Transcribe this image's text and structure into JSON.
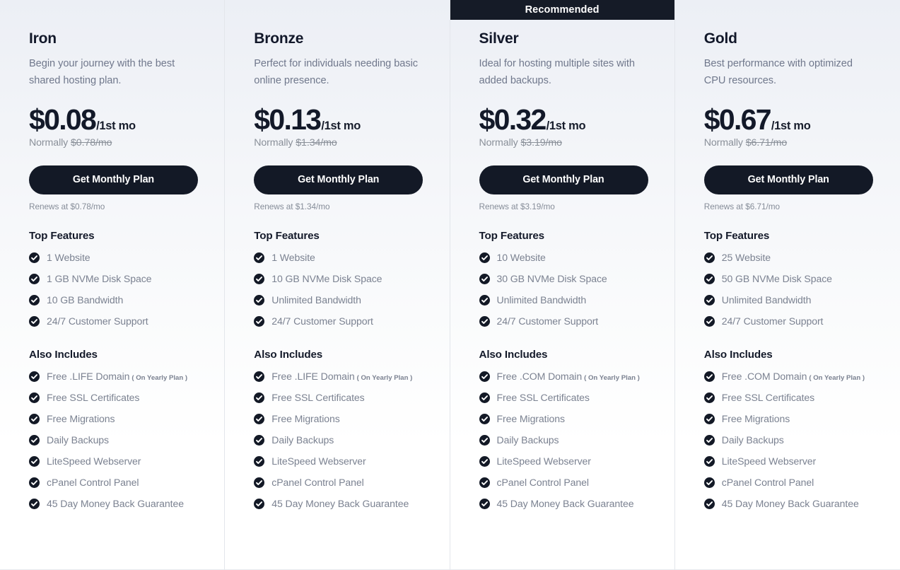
{
  "theme": {
    "accent_dark": "#131926",
    "banner_bg": "#151b27",
    "text_primary": "#12182a",
    "text_muted": "#70788c",
    "feature_text": "#7b8291",
    "divider": "#e3e6eb",
    "card_gradient_top": "#eceff5",
    "card_gradient_bottom": "#ffffff"
  },
  "labels": {
    "top_features_title": "Top Features",
    "also_includes_title": "Also Includes",
    "recommended_badge": "Recommended",
    "cta_label": "Get Monthly Plan",
    "normally_prefix": "Normally",
    "renews_prefix": "Renews at",
    "yearly_note": "( On Yearly Plan )",
    "check_icon_name": "check-circle-icon"
  },
  "plans": [
    {
      "name": "Iron",
      "description": "Begin your journey with the best shared hosting plan.",
      "price": "$0.08",
      "price_suffix": "/1st mo",
      "normally_price": "$0.78/mo",
      "normally_text": "Normally $0.78/mo",
      "cta_label": "Get Monthly Plan",
      "renews_text": "Renews at $0.78/mo",
      "recommended": false,
      "top_features": [
        "1 Website",
        "1 GB NVMe Disk Space",
        "10 GB Bandwidth",
        "24/7 Customer Support"
      ],
      "also_includes": [
        {
          "text": "Free .LIFE Domain",
          "note": "( On Yearly Plan )"
        },
        {
          "text": "Free SSL Certificates",
          "note": ""
        },
        {
          "text": "Free Migrations",
          "note": ""
        },
        {
          "text": "Daily Backups",
          "note": ""
        },
        {
          "text": "LiteSpeed Webserver",
          "note": ""
        },
        {
          "text": "cPanel Control Panel",
          "note": ""
        },
        {
          "text": "45 Day Money Back Guarantee",
          "note": ""
        }
      ]
    },
    {
      "name": "Bronze",
      "description": "Perfect for individuals needing basic online presence.",
      "price": "$0.13",
      "price_suffix": "/1st mo",
      "normally_price": "$1.34/mo",
      "normally_text": "Normally $1.34/mo",
      "cta_label": "Get Monthly Plan",
      "renews_text": "Renews at $1.34/mo",
      "recommended": false,
      "top_features": [
        "1 Website",
        "10 GB NVMe Disk Space",
        "Unlimited Bandwidth",
        "24/7 Customer Support"
      ],
      "also_includes": [
        {
          "text": "Free .LIFE Domain",
          "note": "( On Yearly Plan )"
        },
        {
          "text": "Free SSL Certificates",
          "note": ""
        },
        {
          "text": "Free Migrations",
          "note": ""
        },
        {
          "text": "Daily Backups",
          "note": ""
        },
        {
          "text": "LiteSpeed Webserver",
          "note": ""
        },
        {
          "text": "cPanel Control Panel",
          "note": ""
        },
        {
          "text": "45 Day Money Back Guarantee",
          "note": ""
        }
      ]
    },
    {
      "name": "Silver",
      "description": "Ideal for hosting multiple sites with added backups.",
      "price": "$0.32",
      "price_suffix": "/1st mo",
      "normally_price": "$3.19/mo",
      "normally_text": "Normally $3.19/mo",
      "cta_label": "Get Monthly Plan",
      "renews_text": "Renews at $3.19/mo",
      "recommended": true,
      "badge_label": "Recommended",
      "top_features": [
        "10 Website",
        "30 GB NVMe Disk Space",
        "Unlimited Bandwidth",
        "24/7 Customer Support"
      ],
      "also_includes": [
        {
          "text": "Free .COM Domain",
          "note": "( On Yearly Plan )"
        },
        {
          "text": "Free SSL Certificates",
          "note": ""
        },
        {
          "text": "Free Migrations",
          "note": ""
        },
        {
          "text": "Daily Backups",
          "note": ""
        },
        {
          "text": "LiteSpeed Webserver",
          "note": ""
        },
        {
          "text": "cPanel Control Panel",
          "note": ""
        },
        {
          "text": "45 Day Money Back Guarantee",
          "note": ""
        }
      ]
    },
    {
      "name": "Gold",
      "description": "Best performance with optimized CPU resources.",
      "price": "$0.67",
      "price_suffix": "/1st mo",
      "normally_price": "$6.71/mo",
      "normally_text": "Normally $6.71/mo",
      "cta_label": "Get Monthly Plan",
      "renews_text": "Renews at $6.71/mo",
      "recommended": false,
      "top_features": [
        "25 Website",
        "50 GB NVMe Disk Space",
        "Unlimited Bandwidth",
        "24/7 Customer Support"
      ],
      "also_includes": [
        {
          "text": "Free .COM Domain",
          "note": "( On Yearly Plan )"
        },
        {
          "text": "Free SSL Certificates",
          "note": ""
        },
        {
          "text": "Free Migrations",
          "note": ""
        },
        {
          "text": "Daily Backups",
          "note": ""
        },
        {
          "text": "LiteSpeed Webserver",
          "note": ""
        },
        {
          "text": "cPanel Control Panel",
          "note": ""
        },
        {
          "text": "45 Day Money Back Guarantee",
          "note": ""
        }
      ]
    }
  ]
}
